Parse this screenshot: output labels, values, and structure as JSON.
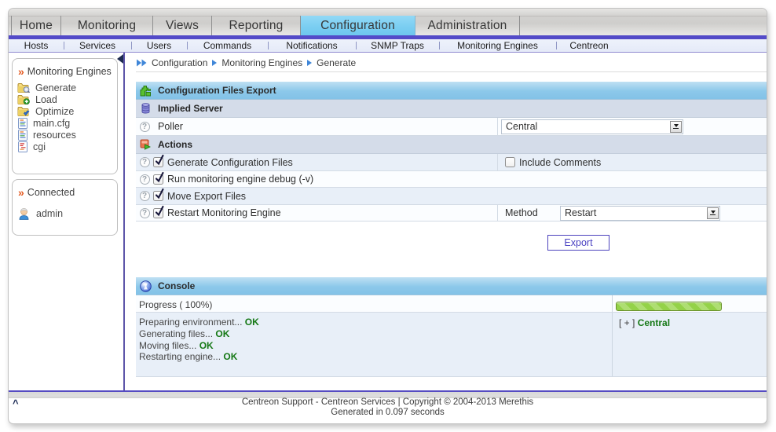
{
  "tabs": {
    "items": [
      {
        "label": "Home",
        "active": false
      },
      {
        "label": "Monitoring",
        "active": false
      },
      {
        "label": "Views",
        "active": false
      },
      {
        "label": "Reporting",
        "active": false
      },
      {
        "label": "Configuration",
        "active": true
      },
      {
        "label": "Administration",
        "active": false
      }
    ]
  },
  "submenu": {
    "items": [
      {
        "label": "Hosts"
      },
      {
        "label": "Services"
      },
      {
        "label": "Users"
      },
      {
        "label": "Commands"
      },
      {
        "label": "Notifications"
      },
      {
        "label": "SNMP Traps"
      },
      {
        "label": "Monitoring Engines"
      },
      {
        "label": "Centreon"
      }
    ]
  },
  "breadcrumb": {
    "items": [
      "Configuration",
      "Monitoring Engines",
      "Generate"
    ]
  },
  "sidebar": {
    "box1": {
      "title": "Monitoring Engines",
      "items": [
        {
          "label": "Generate",
          "icon": "folder-magnifier-icon"
        },
        {
          "label": "Load",
          "icon": "folder-add-icon"
        },
        {
          "label": "Optimize",
          "icon": "folder-check-icon"
        },
        {
          "label": "main.cfg",
          "icon": "file-config-icon"
        },
        {
          "label": "resources",
          "icon": "file-config-icon"
        },
        {
          "label": "cgi",
          "icon": "file-red-icon"
        }
      ]
    },
    "box2": {
      "title": "Connected",
      "user": "admin"
    }
  },
  "form": {
    "title": "Configuration Files Export",
    "sections": {
      "server": "Implied Server",
      "actions": "Actions"
    },
    "poller": {
      "label": "Poller",
      "value": "Central"
    },
    "rows": [
      {
        "label": "Generate Configuration Files",
        "checked": true
      },
      {
        "label": "Run monitoring engine debug (-v)",
        "checked": true
      },
      {
        "label": "Move Export Files",
        "checked": true
      },
      {
        "label": "Restart Monitoring Engine",
        "checked": true
      }
    ],
    "include_comments": {
      "label": "Include Comments",
      "checked": false
    },
    "method": {
      "label": "Method",
      "value": "Restart"
    },
    "export_label": "Export"
  },
  "console": {
    "title": "Console",
    "progress_label": "Progress ( 100%)",
    "progress_percent": 100,
    "logs": [
      {
        "text": "Preparing environment...",
        "status": "OK"
      },
      {
        "text": "Generating files...",
        "status": "OK"
      },
      {
        "text": "Moving files...",
        "status": "OK"
      },
      {
        "text": "Restarting engine...",
        "status": "OK"
      }
    ],
    "poller_toggle": "[ + ]",
    "poller_name": "Central"
  },
  "footer": {
    "line1": "Centreon Support - Centreon Services | Copyright © 2004-2013 Merethis",
    "line2": "Generated in 0.097 seconds",
    "scroll_top": "^"
  },
  "colors": {
    "accent_purple": "#544bc8",
    "active_tab_blue": "#7bcef2",
    "header_blue": "#8cc8ea",
    "ok_green": "#157815"
  }
}
